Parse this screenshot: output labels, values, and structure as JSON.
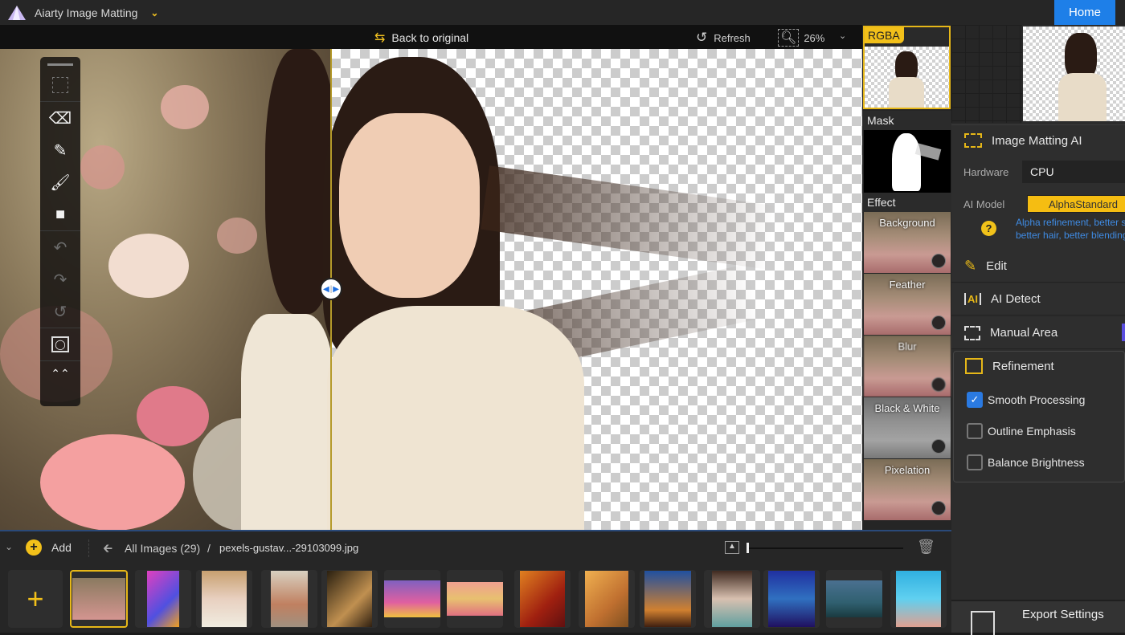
{
  "app": {
    "title": "Aiarty Image Matting",
    "home_label": "Home"
  },
  "toolbar": {
    "back_to_original": "Back to original",
    "refresh": "Refresh",
    "zoom_level": "26%"
  },
  "tools": [
    {
      "name": "crop-select-tool",
      "icon": "marquee-icon",
      "enabled": false
    },
    {
      "name": "eraser-tool",
      "icon": "eraser-icon",
      "enabled": true
    },
    {
      "name": "pen-brush-tool",
      "icon": "pen-icon",
      "enabled": true
    },
    {
      "name": "paint-brush-tool",
      "icon": "brush-icon",
      "enabled": true
    },
    {
      "name": "roller-tool",
      "icon": "paint-roller-icon",
      "enabled": true
    },
    {
      "name": "undo-tool",
      "icon": "undo-icon",
      "enabled": false
    },
    {
      "name": "redo-tool",
      "icon": "redo-icon",
      "enabled": false
    },
    {
      "name": "reset-tool",
      "icon": "reset-icon",
      "enabled": false
    },
    {
      "name": "mask-view-tool",
      "icon": "mask-frame-icon",
      "enabled": true
    },
    {
      "name": "collapse-tool",
      "icon": "double-chevron-up-icon",
      "enabled": true
    }
  ],
  "strip": {
    "rgba_label": "RGBA",
    "mask_label": "Mask",
    "effect_label": "Effect",
    "effects": [
      "Background",
      "Feather",
      "Blur",
      "Black & White",
      "Pixelation"
    ]
  },
  "panel": {
    "matting_title": "Image Matting AI",
    "hardware_label": "Hardware",
    "hardware_value": "CPU",
    "model_label": "AI Model",
    "model_value": "AlphaStandard",
    "model_desc_1": "Alpha refinement, better s",
    "model_desc_2": "better hair, better blending",
    "edit": "Edit",
    "ai_detect": "AI Detect",
    "manual_area": "Manual Area",
    "refinement": "Refinement",
    "options": [
      {
        "label": "Smooth Processing",
        "checked": true
      },
      {
        "label": "Outline Emphasis",
        "checked": false
      },
      {
        "label": "Balance Brightness",
        "checked": false
      }
    ],
    "export": "Export Settings"
  },
  "bottom": {
    "add_label": "Add",
    "breadcrumb_root": "All Images (29)",
    "breadcrumb_sep": "/",
    "breadcrumb_file": "pexels-gustav...-29103099.jpg",
    "thumb_size_fraction": 0.0
  },
  "colors": {
    "accent": "#f2c01a",
    "home": "#1e7fe8",
    "checkbox": "#2a7ae2",
    "link": "#3f8be3"
  }
}
